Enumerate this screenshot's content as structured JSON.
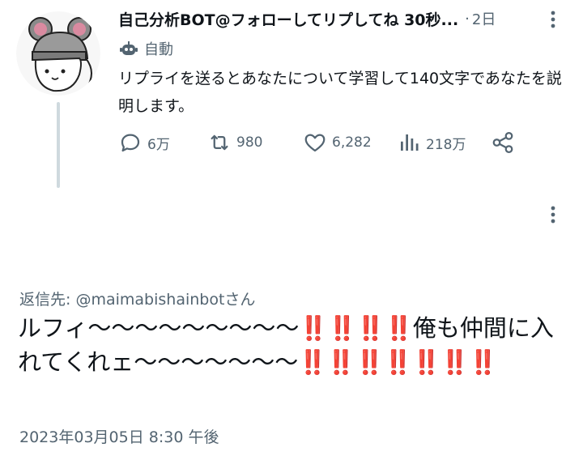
{
  "parent_tweet": {
    "display_name": "自己分析BOT@フォローしてリプしてね 30秒...",
    "dot": "·",
    "time_ago": "2日",
    "automated_label": "自動",
    "text": "リプライを送るとあなたについて学習して140文字であなたを説明します。",
    "actions": {
      "replies": "6万",
      "retweets": "980",
      "likes": "6,282",
      "views": "218万"
    }
  },
  "main_tweet": {
    "reply_prefix": "返信先: ",
    "reply_handle": "@maimabishainbot",
    "reply_suffix": "さん",
    "text_part1": "ルフィ〜〜〜〜〜〜〜〜〜",
    "bangs1": "‼️‼️‼️‼️",
    "text_part2": "俺も仲間に入れてくれェ〜〜〜〜〜〜〜",
    "bangs2": "‼️‼️‼️‼️‼️‼️‼️",
    "timestamp": "2023年03月05日 8:30 午後"
  },
  "colors": {
    "text_primary": "#0f1419",
    "text_secondary": "#536471",
    "thread_line": "#cfd9de",
    "emoji_red": "#c8102e"
  },
  "icons": [
    "mouse-hat-avatar",
    "more-dots-icon",
    "robot-icon",
    "reply-icon",
    "retweet-icon",
    "like-icon",
    "views-icon",
    "share-icon"
  ]
}
